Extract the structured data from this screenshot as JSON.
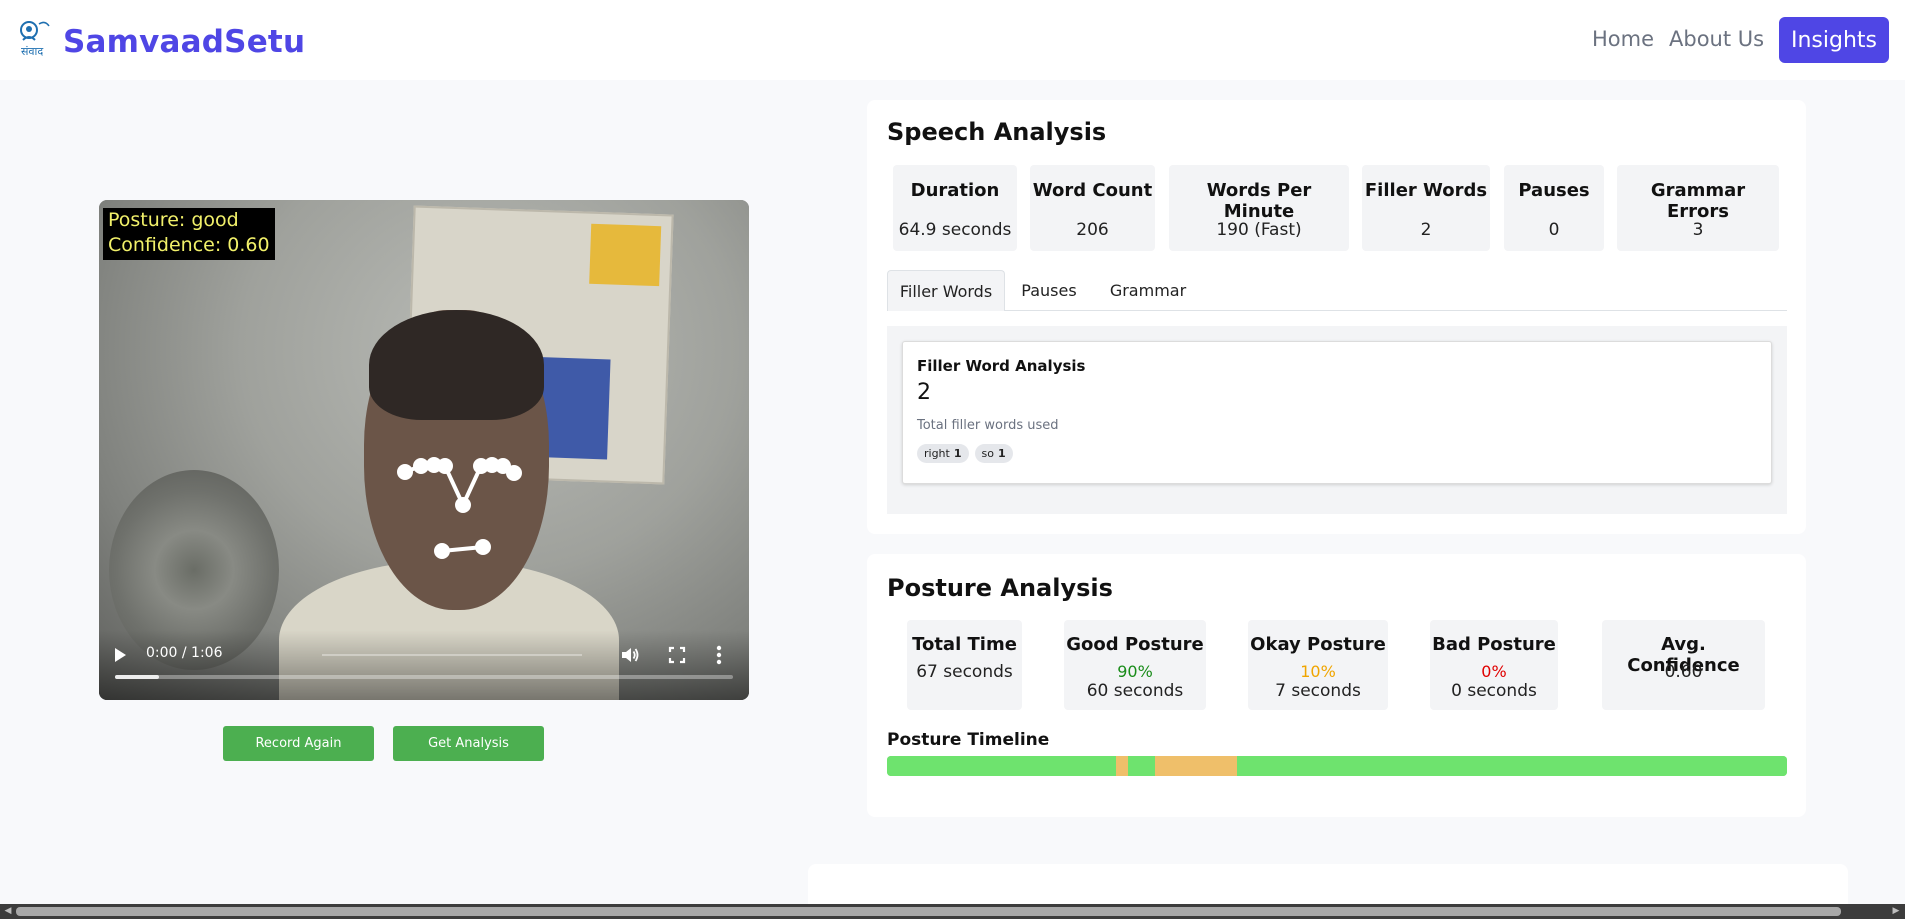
{
  "header": {
    "logo_text": "SamvaadSetu",
    "logo_icon_label": "संवाद",
    "nav": {
      "home": "Home",
      "about": "About Us",
      "insights": "Insights"
    }
  },
  "video": {
    "overlay_posture": "Posture: good",
    "overlay_confidence": "Confidence: 0.60",
    "time": "0:00 / 1:06",
    "progress_fraction": 0
  },
  "buttons": {
    "record_again": "Record Again",
    "get_analysis": "Get Analysis"
  },
  "speech": {
    "title": "Speech Analysis",
    "stats": [
      {
        "label": "Duration",
        "value": "64.9 seconds"
      },
      {
        "label": "Word Count",
        "value": "206"
      },
      {
        "label": "Words Per Minute",
        "value": "190 (Fast)"
      },
      {
        "label": "Filler Words",
        "value": "2"
      },
      {
        "label": "Pauses",
        "value": "0"
      },
      {
        "label": "Grammar Errors",
        "value": "3"
      }
    ],
    "tabs": [
      "Filler Words",
      "Pauses",
      "Grammar"
    ],
    "active_tab": "Filler Words",
    "filler": {
      "title": "Filler Word Analysis",
      "count": "2",
      "description": "Total filler words used",
      "chips": [
        {
          "word": "right",
          "count": "1"
        },
        {
          "word": "so",
          "count": "1"
        }
      ]
    }
  },
  "posture": {
    "title": "Posture Analysis",
    "total": {
      "label": "Total Time",
      "value": "67 seconds"
    },
    "good": {
      "label": "Good Posture",
      "percent": "90%",
      "seconds": "60 seconds"
    },
    "okay": {
      "label": "Okay Posture",
      "percent": "10%",
      "seconds": "7 seconds"
    },
    "bad": {
      "label": "Bad Posture",
      "percent": "0%",
      "seconds": "0 seconds"
    },
    "confidence": {
      "label": "Avg. Confidence",
      "value": "0.60"
    },
    "timeline_title": "Posture Timeline",
    "timeline": [
      {
        "state": "good",
        "from": 0,
        "to": 0.254
      },
      {
        "state": "okay",
        "from": 0.254,
        "to": 0.268
      },
      {
        "state": "good",
        "from": 0.268,
        "to": 0.298
      },
      {
        "state": "okay",
        "from": 0.298,
        "to": 0.389
      },
      {
        "state": "good",
        "from": 0.389,
        "to": 1.0
      }
    ],
    "colors": {
      "good": "#6ee36e",
      "okay": "#efbf6a",
      "bad": "#e05252",
      "good_text": "#198c19",
      "okay_text": "#f0a500",
      "bad_text": "#e00000"
    }
  },
  "colors": {
    "brand": "#4f46e5",
    "button_green": "#4caf50"
  },
  "icons": {
    "logo": "speech-bubble-person-icon",
    "play": "play-icon",
    "volume": "volume-icon",
    "fullscreen": "fullscreen-icon",
    "more": "more-vertical-icon"
  }
}
